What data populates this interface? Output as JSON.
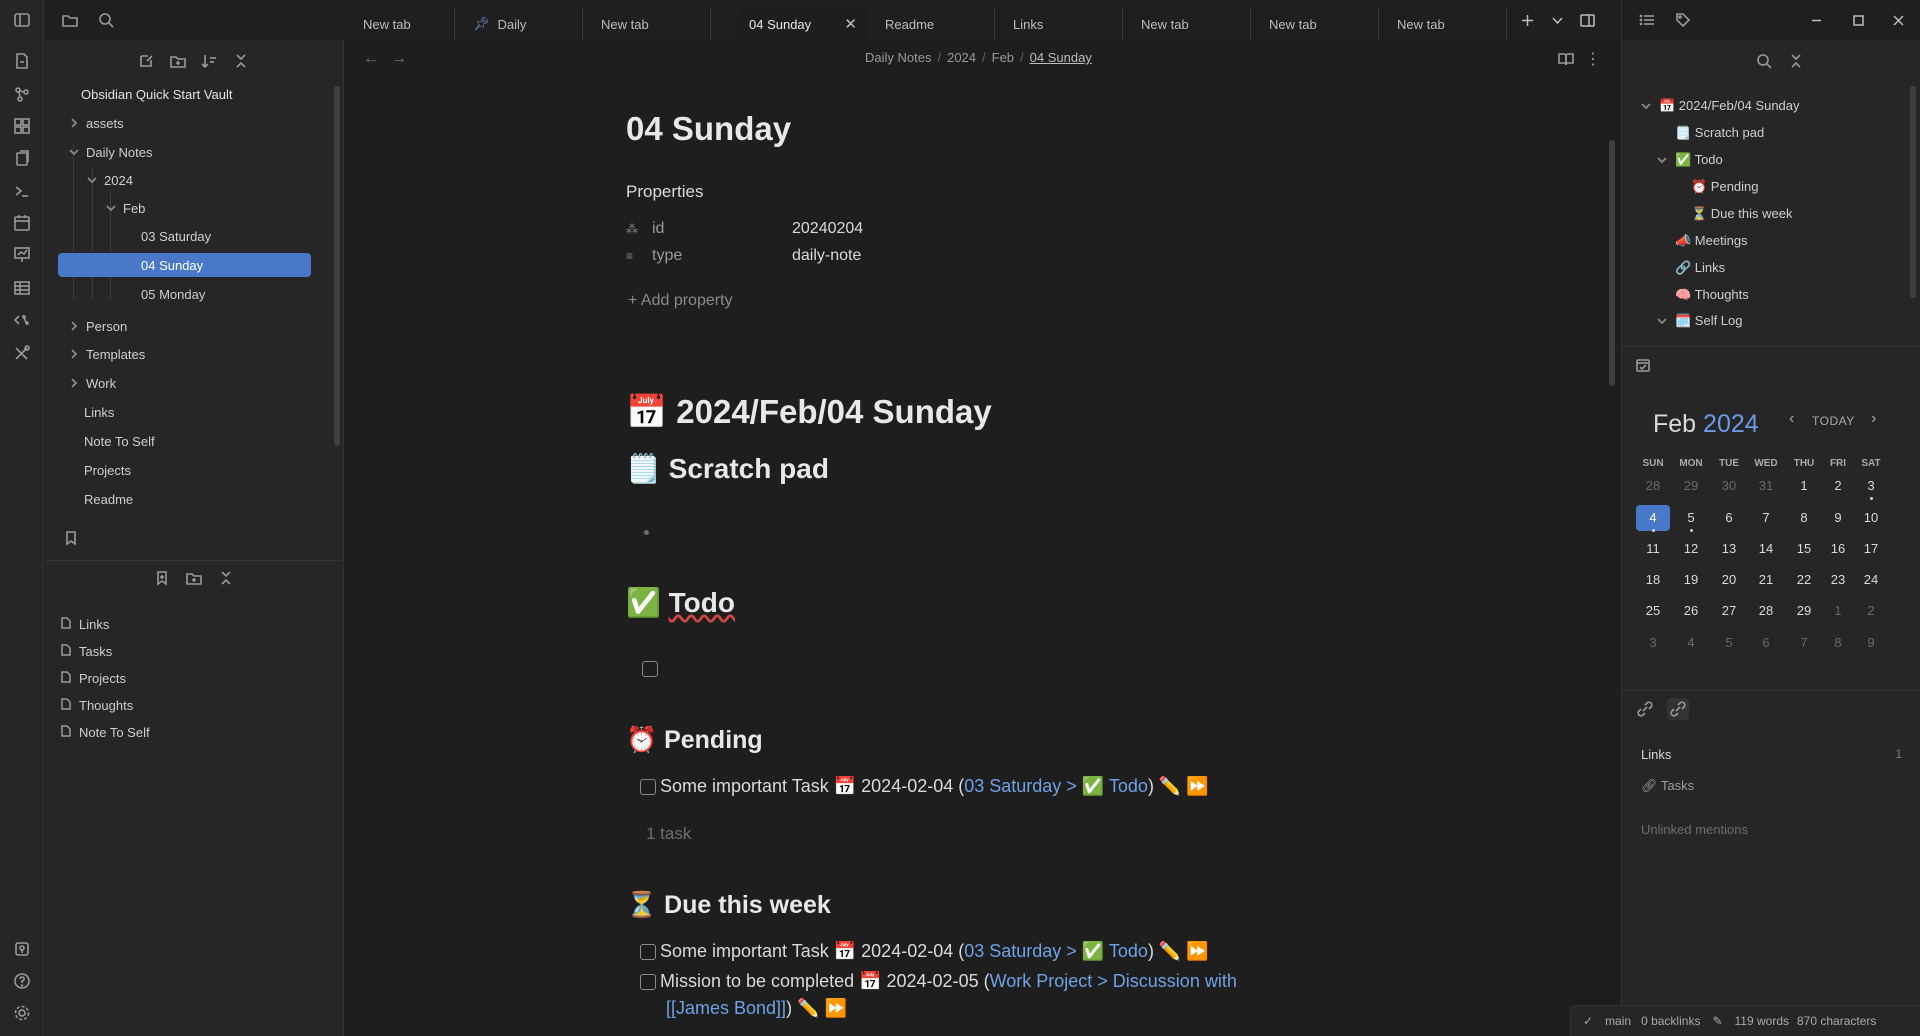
{
  "tabs": [
    {
      "label": "New tab",
      "pinned": false,
      "active": false
    },
    {
      "label": "Daily",
      "pinned": true,
      "active": false
    },
    {
      "label": "New tab",
      "pinned": false,
      "active": false
    },
    {
      "label": "04 Sunday",
      "pinned": false,
      "active": true
    },
    {
      "label": "Readme",
      "pinned": false,
      "active": false
    },
    {
      "label": "Links",
      "pinned": false,
      "active": false
    },
    {
      "label": "New tab",
      "pinned": false,
      "active": false
    },
    {
      "label": "New tab",
      "pinned": false,
      "active": false
    },
    {
      "label": "New tab",
      "pinned": false,
      "active": false
    }
  ],
  "file_explorer": {
    "vault_name": "Obsidian Quick Start Vault",
    "items": [
      {
        "label": "assets",
        "type": "folder",
        "expanded": false
      },
      {
        "label": "Daily Notes",
        "type": "folder",
        "expanded": true
      },
      {
        "label": "2024",
        "type": "folder",
        "expanded": true
      },
      {
        "label": "Feb",
        "type": "folder",
        "expanded": true
      },
      {
        "label": "03 Saturday",
        "type": "file"
      },
      {
        "label": "04 Sunday",
        "type": "file",
        "selected": true
      },
      {
        "label": "05 Monday",
        "type": "file"
      },
      {
        "label": "Person",
        "type": "folder",
        "expanded": false
      },
      {
        "label": "Templates",
        "type": "folder",
        "expanded": false
      },
      {
        "label": "Work",
        "type": "folder",
        "expanded": false
      },
      {
        "label": "Links",
        "type": "file"
      },
      {
        "label": "Note To Self",
        "type": "file"
      },
      {
        "label": "Projects",
        "type": "file"
      },
      {
        "label": "Readme",
        "type": "file"
      }
    ]
  },
  "bookmarks": [
    "Links",
    "Tasks",
    "Projects",
    "Thoughts",
    "Note To Self"
  ],
  "breadcrumb": [
    "Daily Notes",
    "2024",
    "Feb",
    "04 Sunday"
  ],
  "note": {
    "title": "04 Sunday",
    "properties_heading": "Properties",
    "properties": [
      {
        "key": "id",
        "value": "20240204",
        "icon": "number-icon"
      },
      {
        "key": "type",
        "value": "daily-note",
        "icon": "text-icon"
      }
    ],
    "add_property": "+ Add property",
    "h1": "📅 2024/Feb/04 Sunday",
    "scratch_heading": "🗒️ Scratch pad",
    "todo_heading_emoji": "✅",
    "todo_heading_text": "Todo",
    "pending_heading": "⏰ Pending",
    "pending_task": {
      "text": "Some important Task 📅 2024-02-04 (",
      "link": "03 Saturday > ✅ Todo",
      "tail": ") ✏️ ⏩"
    },
    "pending_count": "1 task",
    "due_heading": "⏳ Due this week",
    "due_tasks": [
      {
        "text": "Some important Task 📅 2024-02-04 (",
        "link": "03 Saturday > ✅ Todo",
        "tail": ") ✏️ ⏩"
      },
      {
        "text": "Mission to be completed 📅 2024-02-05 (",
        "link": "Work Project > Discussion with",
        "link2": "[[James Bond]]",
        "tail": ") ✏️ ⏩"
      }
    ]
  },
  "outline": [
    {
      "label": "📅 2024/Feb/04 Sunday",
      "level": 0,
      "collapsible": true
    },
    {
      "label": "🗒️ Scratch pad",
      "level": 1,
      "collapsible": false
    },
    {
      "label": "✅ Todo",
      "level": 1,
      "collapsible": true
    },
    {
      "label": "⏰ Pending",
      "level": 2,
      "collapsible": false
    },
    {
      "label": "⏳ Due this week",
      "level": 2,
      "collapsible": false
    },
    {
      "label": "📣 Meetings",
      "level": 1,
      "collapsible": false
    },
    {
      "label": "🔗 Links",
      "level": 1,
      "collapsible": false
    },
    {
      "label": "🧠 Thoughts",
      "level": 1,
      "collapsible": false
    },
    {
      "label": "🗓️ Self Log",
      "level": 1,
      "collapsible": true
    }
  ],
  "calendar": {
    "month": "Feb",
    "year": "2024",
    "today_label": "TODAY",
    "dow": [
      "SUN",
      "MON",
      "TUE",
      "WED",
      "THU",
      "FRI",
      "SAT"
    ],
    "weeks": [
      [
        "28",
        "29",
        "30",
        "31",
        "1",
        "2",
        "3"
      ],
      [
        "4",
        "5",
        "6",
        "7",
        "8",
        "9",
        "10"
      ],
      [
        "11",
        "12",
        "13",
        "14",
        "15",
        "16",
        "17"
      ],
      [
        "18",
        "19",
        "20",
        "21",
        "22",
        "23",
        "24"
      ],
      [
        "25",
        "26",
        "27",
        "28",
        "29",
        "1",
        "2"
      ],
      [
        "3",
        "4",
        "5",
        "6",
        "7",
        "8",
        "9"
      ]
    ]
  },
  "backlinks": {
    "title": "Links",
    "count": "1",
    "item": "Tasks",
    "unlinked": "Unlinked mentions"
  },
  "status": {
    "branch": "main",
    "backlinks": "0 backlinks",
    "words": "119 words",
    "chars": "870 characters"
  },
  "colors": {
    "accent": "#4a78c9",
    "link": "#6ea2e6",
    "bg": "#1e1e1e",
    "panel": "#262626"
  }
}
